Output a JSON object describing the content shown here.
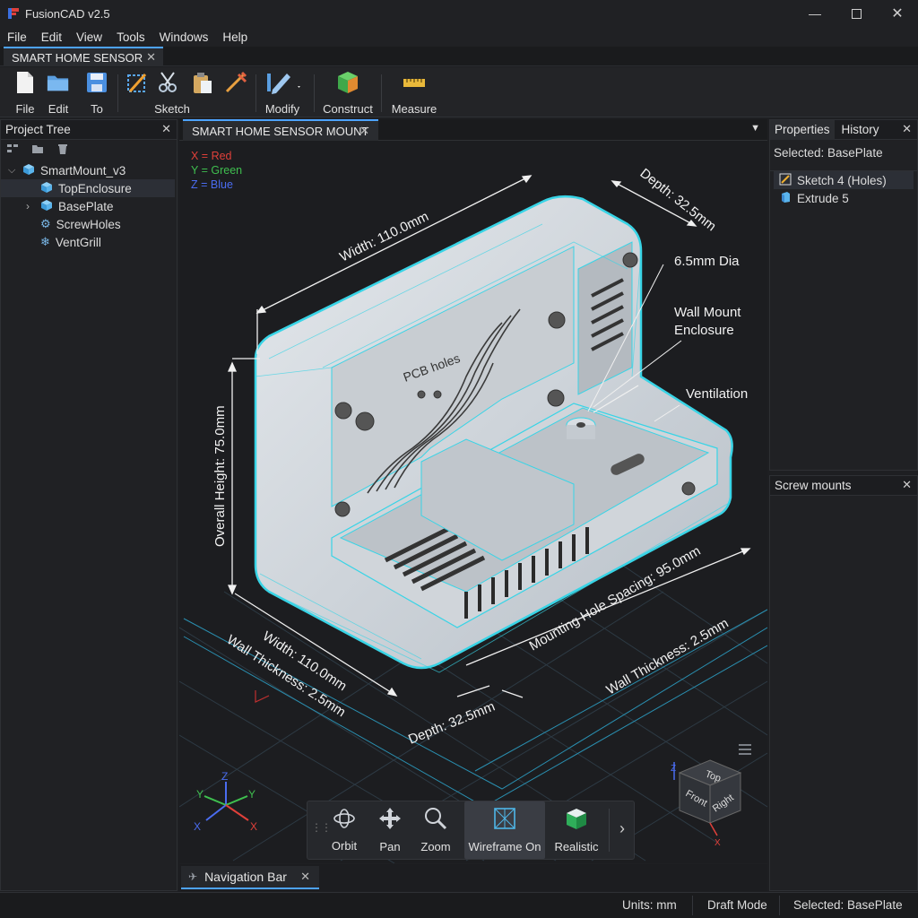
{
  "window": {
    "title": "FusionCAD v2.5",
    "controls": [
      "minimize",
      "maximize",
      "close"
    ]
  },
  "menu": [
    "File",
    "Edit",
    "View",
    "Tools",
    "Windows",
    "Help"
  ],
  "document_tab": {
    "label": "SMART HOME SENSOR"
  },
  "toolbar": {
    "buttons": [
      {
        "label": "File",
        "icon": "new-file-icon"
      },
      {
        "label": "Edit",
        "icon": "folder-icon"
      },
      {
        "label": "To",
        "icon": "save-icon"
      },
      {
        "label": "Sketch",
        "icon": "sketch-icon"
      },
      {
        "label": "Modify",
        "icon": "pencil-icon"
      },
      {
        "label": "Construct",
        "icon": "cube-icon"
      },
      {
        "label": "Measure",
        "icon": "ruler-icon"
      }
    ]
  },
  "project_tree": {
    "title": "Project Tree",
    "root": "SmartMount_v3",
    "items": [
      "TopEnclosure",
      "BasePlate",
      "ScrewHoles",
      "VentGrill"
    ]
  },
  "viewport": {
    "tab_label": "SMART HOME SENSOR MOUNT",
    "axis_legend": [
      "X = Red",
      "Y = Green",
      "Z = Blue"
    ],
    "annotations": {
      "depth_top": "Depth: 32.5mm",
      "width_top": "Width: 110.0mm",
      "hole_dia": "6.5mm Dia",
      "wall_mount": "Wall Mount Enclosure",
      "ventilation": "Ventilation",
      "pcb_holes": "PCB holes",
      "overall_height": "Overall Height: 75.0mm",
      "width_bottom": "Width: 110.0mm",
      "wall_thickness_left": "Wall Thickness: 2.5mm",
      "depth_bottom": "Depth: 32.5mm",
      "mounting_spacing": "Mounting Hole Spacing: 95.0mm",
      "wall_thickness_right": "Wall Thickness: 2.5mm"
    },
    "triad_labels": [
      "Z",
      "Y",
      "Y",
      "X",
      "X"
    ],
    "view_cube": {
      "top": "Top",
      "front": "Front",
      "right": "Right"
    }
  },
  "navigation_bar": {
    "buttons": [
      "Orbit",
      "Pan",
      "Zoom",
      "Wireframe On",
      "Realistic"
    ],
    "active": "Wireframe On"
  },
  "right_panel": {
    "tabs": [
      "Properties",
      "History"
    ],
    "selected_label": "Selected: BasePlate",
    "history_items": [
      "Sketch 4 (Holes)",
      "Extrude 5"
    ],
    "lower_title": "Screw mounts"
  },
  "bottom_tab": {
    "label": "Navigation Bar"
  },
  "status": {
    "units": "Units: mm",
    "mode": "Draft Mode",
    "selected": "Selected: BasePlate"
  },
  "colors": {
    "accent": "#4da3ff",
    "wireframe": "#38d4e6",
    "axis_x": "#e0403a",
    "axis_y": "#3fbf4f",
    "axis_z": "#4a6cf0"
  }
}
